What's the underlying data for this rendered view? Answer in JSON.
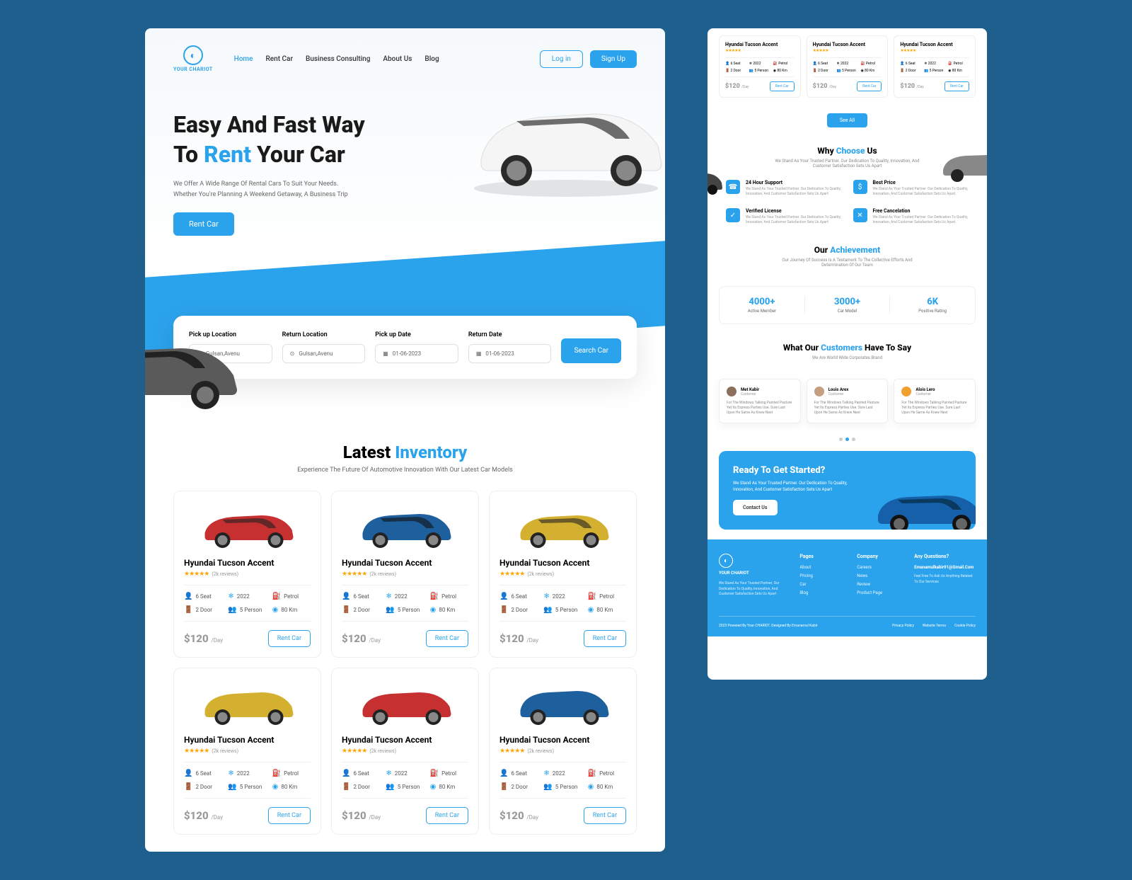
{
  "brand": {
    "name": "YOUR CHARIOT"
  },
  "nav": {
    "home": "Home",
    "rent": "Rent Car",
    "consult": "Business Consulting",
    "about": "About Us",
    "blog": "Blog",
    "login": "Log in",
    "signup": "Sign Up"
  },
  "hero": {
    "title1": "Easy And Fast Way",
    "title2a": "To ",
    "title2b": "Rent",
    "title2c": " Your Car",
    "desc": "We Offer A Wide Range Of Rental Cars To Suit Your Needs. Whether You're Planning A Weekend Getaway, A Business Trip",
    "cta": "Rent Car"
  },
  "search": {
    "labels": {
      "pickup_loc": "Pick up Location",
      "return_loc": "Return Location",
      "pickup_date": "Pick up Date",
      "return_date": "Return Date"
    },
    "values": {
      "pickup_loc": "Gulsan,Avenu",
      "return_loc": "Gulsan,Avenu",
      "pickup_date": "01-06-2023",
      "return_date": "01-06-2023"
    },
    "btn": "Search Car"
  },
  "inventory": {
    "title_a": "Latest ",
    "title_b": "Inventory",
    "sub": "Experience The Future Of Automotive Innovation With Our Latest Car Models",
    "card": {
      "name": "Hyundai Tucson Accent",
      "reviews": "(2k reviews)",
      "specs": {
        "seat": "6 Seat",
        "year": "2022",
        "fuel": "Petrol",
        "door": "2 Door",
        "person": "5 Person",
        "km": "80 Km"
      },
      "price": "$120",
      "per": "/Day",
      "rent": "Rent Car"
    }
  },
  "see_all": "See All",
  "why": {
    "title_a": "Why ",
    "title_b": "Choose",
    "title_c": " Us",
    "sub": "We Stand As Your Trusted Partner. Our Dedication To Quality, Innovation, And Customer Satisfaction Sets Us Apart",
    "features": {
      "f1t": "24 Hour Support",
      "f2t": "Best Price",
      "f3t": "Verified License",
      "f4t": "Free Cancelation",
      "fd": "We Stand As Your Trusted Partner. Our Dedication To Quality, Innovation, And Customer Satisfaction Sets Us Apart"
    }
  },
  "achievement": {
    "title_a": "Our ",
    "title_b": "Achievement",
    "sub": "Our Journey Of Success Is A Testament To The Collective Efforts And Determination Of Our Team",
    "s1n": "4000+",
    "s1l": "Active Member",
    "s2n": "3000+",
    "s2l": "Car Model",
    "s3n": "6K",
    "s3l": "Positive Rating"
  },
  "testimonials": {
    "title_a": "What Our ",
    "title_b": "Customers",
    "title_c": " Have To Say",
    "sub": "We Are World Wide Corporates Brand",
    "t1n": "Met Kabir",
    "t2n": "Louis Arex",
    "t3n": "Alois Lero",
    "role": "Customer",
    "txt": "For The Windows Talking Painted Pasture Yet Its Express Parties Use. Sure Last Upon He Same As Knew Next"
  },
  "cta": {
    "title": "Ready To Get Started?",
    "desc": "We Stand As Your Trusted Partner. Our Dedication To Quality, Innovation, And Customer Satisfaction Sets Us Apart",
    "btn": "Contact Us"
  },
  "footer": {
    "c1": {
      "desc": "We Stand As Your Trusted Partner. Our Dedication To Quality, Innovation, And Customer Satisfaction Sets Us Apart"
    },
    "c2": {
      "h": "Pages",
      "i1": "About",
      "i2": "Pricing",
      "i3": "Car",
      "i4": "Blog"
    },
    "c3": {
      "h": "Company",
      "i1": "Careers",
      "i2": "News",
      "i3": "Review",
      "i4": "Product Page"
    },
    "c4": {
      "h": "Any Questions?",
      "email": "Emanamulkabir91@Gmail.Com",
      "txt": "Feel Free To Ask Us Anything Related To Our Services"
    },
    "copy": "2023 Powered By Your CHARIOT. Designed By Emanamul Kabir",
    "l1": "Privacy Policy",
    "l2": "Website Terms",
    "l3": "Cookie Policy"
  }
}
